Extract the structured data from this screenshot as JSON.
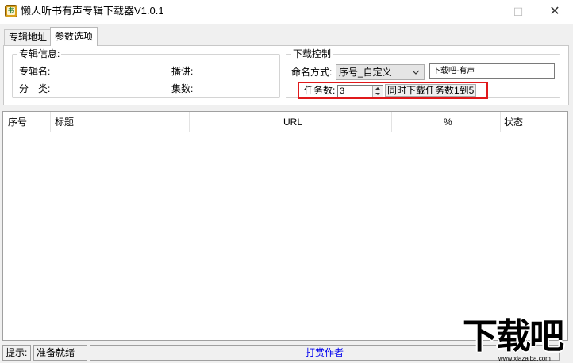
{
  "window": {
    "title": "懒人听书有声专辑下载器V1.0.1",
    "icon_glyph": "书",
    "icon": "app-book-icon",
    "minimize_glyph": "—",
    "maximize_glyph": "☐",
    "close_glyph": "✕"
  },
  "tabs": [
    {
      "label": "专辑地址",
      "active": false
    },
    {
      "label": "参数选项",
      "active": true
    }
  ],
  "album_info": {
    "legend": "专辑信息:",
    "name_label": "专辑名:",
    "narrator_label": "播讲:",
    "category_label": "分　类:",
    "episodes_label": "集数:"
  },
  "download_control": {
    "legend": "下载控制",
    "naming_label": "命名方式:",
    "naming_value": "序号_自定义",
    "custom_text": "下载吧-有声",
    "task_label": "任务数:",
    "task_value": "3",
    "task_hint": "同时下载任务数1到5"
  },
  "table": {
    "columns": [
      "序号",
      "标题",
      "URL",
      "%",
      "状态"
    ],
    "rows": []
  },
  "statusbar": {
    "hint_label": "提示:",
    "status_text": "准备就绪",
    "tip_link": "打赏作者"
  },
  "watermark": {
    "text": "下载吧",
    "url": "www.xiazaiba.com"
  },
  "colors": {
    "highlight": "#e0191b",
    "link": "#0000ee",
    "window_bg": "#f0f0f0"
  }
}
